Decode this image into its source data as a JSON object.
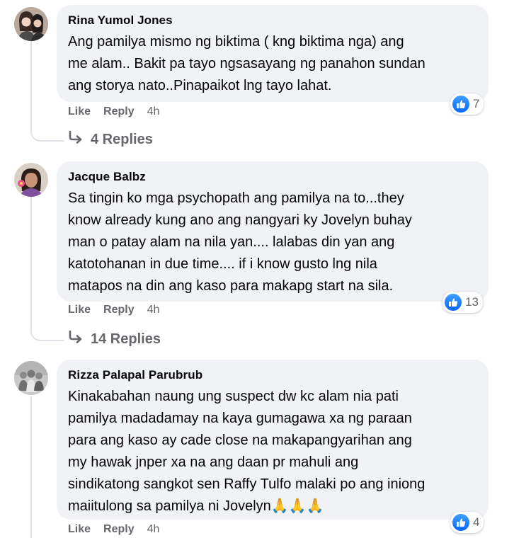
{
  "comments": [
    {
      "author": "Rina Yumol Jones",
      "text": "Ang pamilya mismo ng biktima ( kng biktima nga) ang\nme alam.. Bakit pa tayo ngsasayang ng panahon sundan\nang storya nato..Pinapaikot lng tayo lahat.",
      "like_label": "Like",
      "reply_label": "Reply",
      "time": "4h",
      "reaction_count": "7",
      "replies_label": "4 Replies"
    },
    {
      "author": "Jacque Balbz",
      "text": "Sa tingin ko mga psychopath ang pamilya na to...they\nknow already kung ano ang nangyari ky Jovelyn buhay\nman o patay alam na nila yan.... lalabas din yan ang\nkatotohanan in due time.... if i know gusto lng nila\nmatapos na din ang kaso para makapg start na sila.",
      "like_label": "Like",
      "reply_label": "Reply",
      "time": "4h",
      "reaction_count": "13",
      "replies_label": "14 Replies"
    },
    {
      "author": "Rizza Palapal Parubrub",
      "text": "Kinakabahan naung ung suspect dw kc alam nia pati\npamilya madadamay na kaya gumagawa xa ng paraan\npara ang kaso ay cade close na makapangyarihan ang\nmy hawak jnper xa na ang daan pr mahuli ang\nsindikatong sangkot sen Raffy Tulfo malaki po ang iniong\nmaiitulong sa pamilya ni Jovelyn🙏🙏🙏",
      "like_label": "Like",
      "reply_label": "Reply",
      "time": "4h",
      "reaction_count": "4"
    }
  ],
  "icons": {
    "reaction": "like-thumbs-up-icon",
    "replies": "reply-arrow-icon"
  },
  "colors": {
    "bubble": "#f0f2f5",
    "secondary_text": "#65676b",
    "like_blue": "#0866ff"
  }
}
